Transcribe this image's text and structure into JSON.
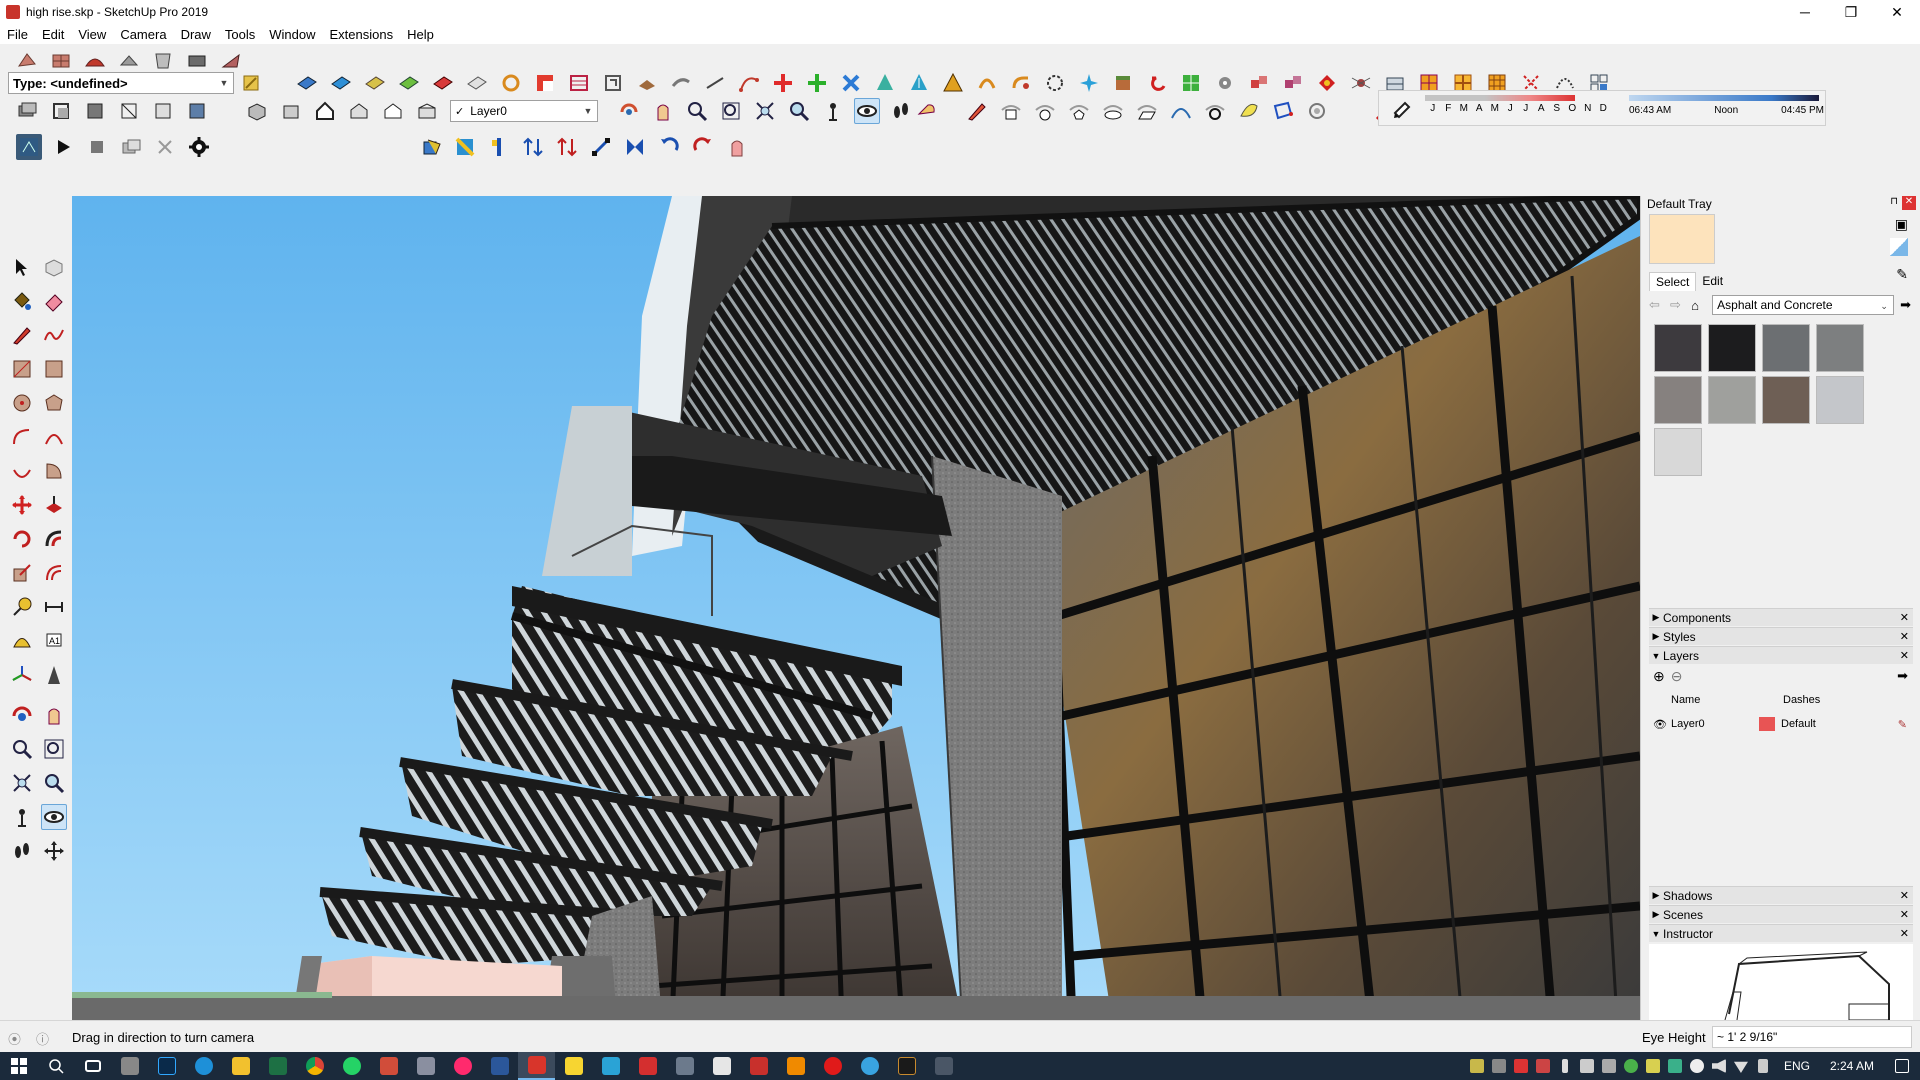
{
  "window": {
    "title": "high rise.skp - SketchUp Pro 2019",
    "minimize": "─",
    "restore": "❐",
    "close": "✕"
  },
  "menu": [
    "File",
    "Edit",
    "View",
    "Camera",
    "Draw",
    "Tools",
    "Window",
    "Extensions",
    "Help"
  ],
  "toolbar": {
    "type_value": "Type: <undefined>",
    "layer_value": "Layer0",
    "layer_check": "✓"
  },
  "shadow": {
    "months": [
      "J",
      "F",
      "M",
      "A",
      "M",
      "J",
      "J",
      "A",
      "S",
      "O",
      "N",
      "D"
    ],
    "time_start": "06:43 AM",
    "time_mid": "Noon",
    "time_end": "04:45 PM"
  },
  "tray": {
    "title": "Default Tray",
    "tab_select": "Select",
    "tab_edit": "Edit",
    "material_collection": "Asphalt and Concrete",
    "material_swatches": [
      "#3d3a3e",
      "#1c1c1e",
      "#6c6f72",
      "#7d7f80",
      "#86817f",
      "#9fa09d",
      "#6e5f55",
      "#c4c6ca",
      "#d8d8d8"
    ],
    "panels": {
      "components": "Components",
      "styles": "Styles",
      "layers": "Layers",
      "shadows": "Shadows",
      "scenes": "Scenes",
      "instructor": "Instructor"
    },
    "layers_columns": {
      "name": "Name",
      "dashes": "Dashes"
    },
    "layers_rows": [
      {
        "name": "Layer0",
        "dashes": "Default",
        "color": "#e85454"
      }
    ]
  },
  "status": {
    "message": "Drag in direction to turn camera",
    "measure_label": "Eye Height",
    "measure_value": "~ 1' 2 9/16\""
  },
  "taskbar": {
    "lang": "ENG",
    "clock": "2:24 AM"
  },
  "colors": {
    "sky": "#7ec8f6",
    "accent": "#0078d7"
  }
}
